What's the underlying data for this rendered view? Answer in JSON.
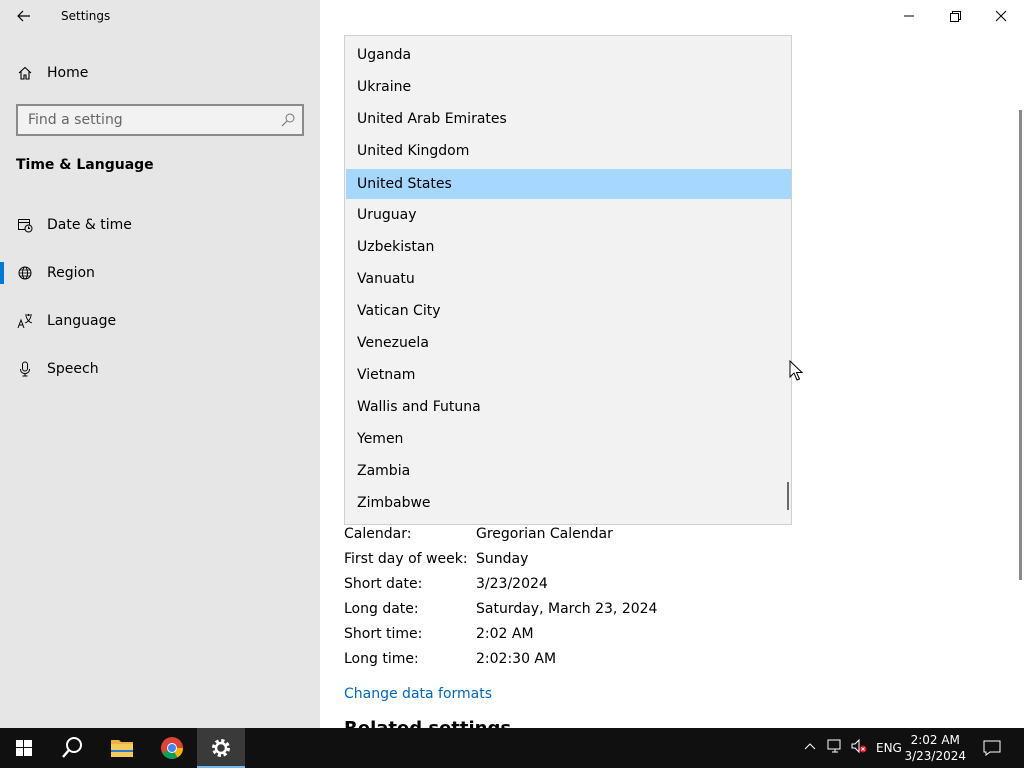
{
  "window": {
    "title": "Settings"
  },
  "sidebar": {
    "home_label": "Home",
    "search_placeholder": "Find a setting",
    "section_title": "Time & Language",
    "items": [
      {
        "label": "Date & time",
        "icon": "calendar-clock-icon",
        "active": false
      },
      {
        "label": "Region",
        "icon": "globe-icon",
        "active": true
      },
      {
        "label": "Language",
        "icon": "language-icon",
        "active": false
      },
      {
        "label": "Speech",
        "icon": "microphone-icon",
        "active": false
      }
    ]
  },
  "country_dropdown": {
    "items": [
      "Uganda",
      "Ukraine",
      "United Arab Emirates",
      "United Kingdom",
      "United States",
      "Uruguay",
      "Uzbekistan",
      "Vanuatu",
      "Vatican City",
      "Venezuela",
      "Vietnam",
      "Wallis and Futuna",
      "Yemen",
      "Zambia",
      "Zimbabwe"
    ],
    "selected": "United States"
  },
  "formats": {
    "rows": [
      {
        "key": "Calendar:",
        "value": "Gregorian Calendar"
      },
      {
        "key": "First day of week:",
        "value": "Sunday"
      },
      {
        "key": "Short date:",
        "value": "3/23/2024"
      },
      {
        "key": "Long date:",
        "value": "Saturday, March 23, 2024"
      },
      {
        "key": "Short time:",
        "value": "2:02 AM"
      },
      {
        "key": "Long time:",
        "value": "2:02:30 AM"
      }
    ],
    "change_link": "Change data formats",
    "related_heading": "Related settings"
  },
  "taskbar": {
    "language": "ENG",
    "time": "2:02 AM",
    "date": "3/23/2024"
  },
  "colors": {
    "accent": "#0078d7",
    "selection": "#a6d8ff",
    "link": "#0067b8"
  }
}
